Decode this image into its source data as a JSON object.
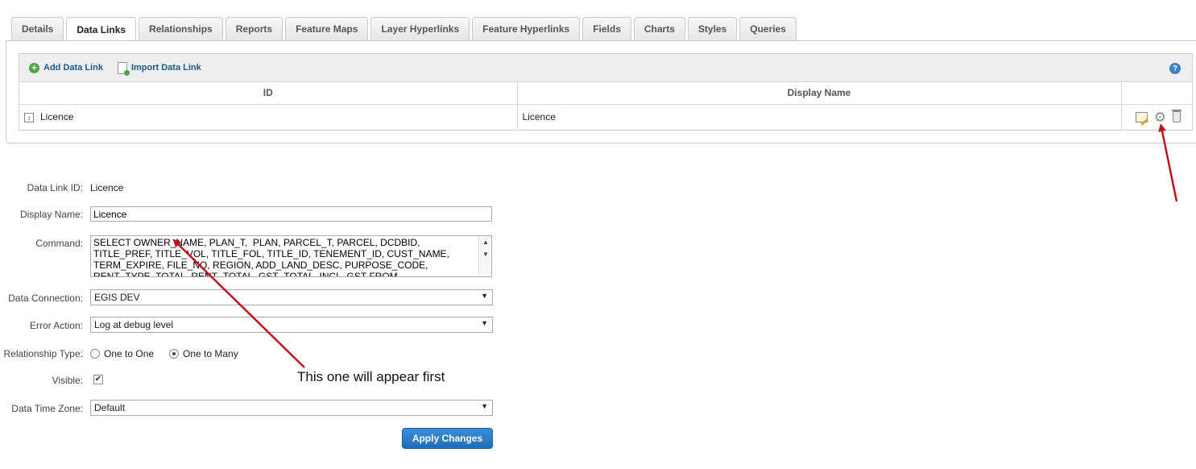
{
  "tabs": [
    "Details",
    "Data Links",
    "Relationships",
    "Reports",
    "Feature Maps",
    "Layer Hyperlinks",
    "Feature Hyperlinks",
    "Fields",
    "Charts",
    "Styles",
    "Queries"
  ],
  "toolbar": {
    "add_label": "Add Data Link",
    "import_label": "Import Data Link",
    "help_glyph": "?"
  },
  "grid": {
    "headers": {
      "id": "ID",
      "display_name": "Display Name",
      "actions": ""
    },
    "rows": [
      {
        "id": "Licence",
        "display_name": "Licence"
      }
    ]
  },
  "form": {
    "data_link_id_label": "Data Link ID:",
    "data_link_id_value": "Licence",
    "display_name_label": "Display Name:",
    "display_name_value": "Licence",
    "command_label": "Command:",
    "command_value": "SELECT OWNER_NAME, PLAN_T,  PLAN, PARCEL_T, PARCEL, DCDBID,\nTITLE_PREF, TITLE_VOL, TITLE_FOL, TITLE_ID, TENEMENT_ID, CUST_NAME,\nTERM_EXPIRE, FILE_NO, REGION, ADD_LAND_DESC, PURPOSE_CODE,\nRENT_TYPE, TOTAL_RENT_TOTAL, GST_TOTAL_INCL_GST FROM",
    "data_connection_label": "Data Connection:",
    "data_connection_value": "EGIS DEV",
    "error_action_label": "Error Action:",
    "error_action_value": "Log at debug level",
    "relationship_type_label": "Relationship Type:",
    "relationship_one_to_one": "One to One",
    "relationship_one_to_many": "One to Many",
    "relationship_selected": "One to Many",
    "visible_label": "Visible:",
    "visible_checked": true,
    "data_time_zone_label": "Data Time Zone:",
    "data_time_zone_value": "Default",
    "apply_label": "Apply Changes"
  },
  "annotation_text": "This one will appear first",
  "colors": {
    "accent": "#1f6db8",
    "arrow": "#c0141c",
    "link": "#1a5a8c"
  },
  "icons": [
    "add-circle-icon",
    "import-icon",
    "help-icon",
    "expand-icon",
    "edit-icon",
    "gear-icon",
    "delete-icon",
    "chevron-down-icon",
    "checkmark-icon"
  ]
}
